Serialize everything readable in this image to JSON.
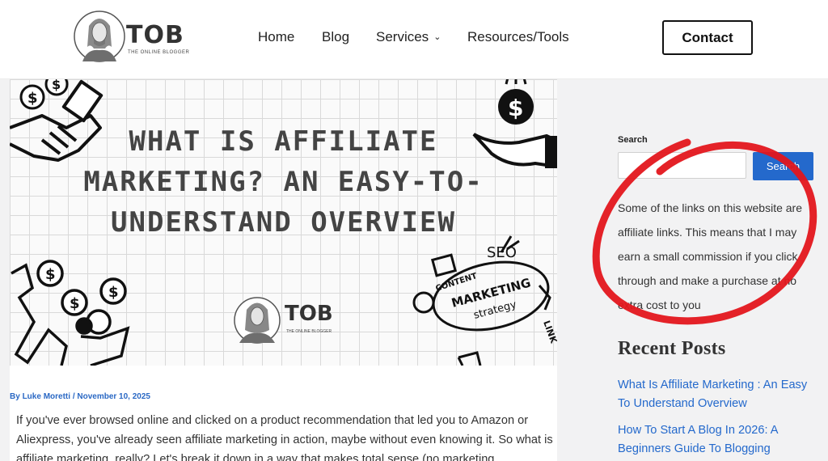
{
  "header": {
    "logo_text": "TOB",
    "logo_subtitle": "THE ONLINE BLOGGER",
    "nav": {
      "home": "Home",
      "blog": "Blog",
      "services": "Services",
      "resources": "Resources/Tools"
    },
    "contact_label": "Contact"
  },
  "hero": {
    "title": "WHAT IS AFFILIATE MARKETING? AN EASY-TO-UNDERSTAND OVERVIEW",
    "logo_text": "TOB",
    "logo_subtitle": "THE ONLINE BLOGGER",
    "doodle_content": "CONTENT",
    "doodle_seo": "SEO",
    "doodle_marketing": "MARKETING",
    "doodle_strategy": "strategy",
    "doodle_link": "LINK"
  },
  "post": {
    "byline_prefix": "By",
    "author": "Luke Moretti",
    "separator": "/",
    "date": "November 10, 2025",
    "intro": "If you've ever browsed online and clicked on a product recommendation that led you to Amazon or Aliexpress, you've already seen affiliate marketing in action, maybe without even knowing it. So what is affiliate marketing, really? Let's break it down in a way that makes total sense (no marketing"
  },
  "sidebar": {
    "search_label": "Search",
    "search_value": "",
    "search_button": "Search",
    "disclosure": "Some of the links on this website are affiliate links. This means that I may earn a small commission if you click through and make a purchase at no extra cost to you",
    "recent_title": "Recent Posts",
    "recent_posts": [
      "What Is Affiliate Marketing : An Easy To Understand Overview",
      "How To Start A Blog In 2026: A Beginners Guide To Blogging"
    ]
  },
  "colors": {
    "accent": "#2469cc",
    "annotation": "#e3161c"
  }
}
